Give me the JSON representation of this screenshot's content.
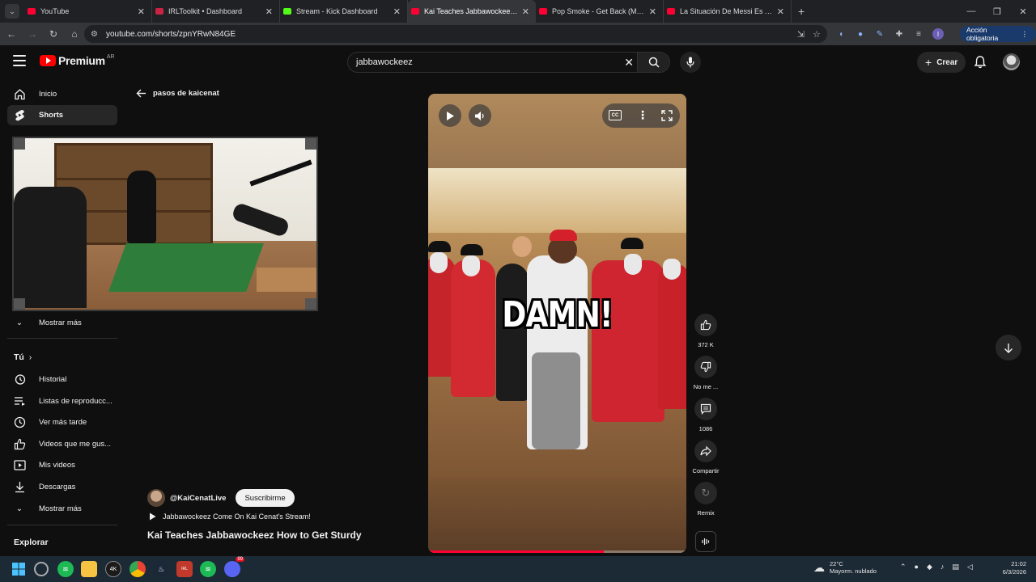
{
  "browser": {
    "tabs": [
      {
        "title": "YouTube",
        "color": "#ff0033",
        "active": false
      },
      {
        "title": "IRLToolkit • Dashboard",
        "color": "#cc2244",
        "active": false
      },
      {
        "title": "Stream - Kick Dashboard",
        "color": "#53fc18",
        "active": false
      },
      {
        "title": "Kai Teaches Jabbawockeez How",
        "color": "#ff0033",
        "active": true
      },
      {
        "title": "Pop Smoke - Get Back (Meet Th",
        "color": "#ff0033",
        "active": false
      },
      {
        "title": "La Situación De Messi Es Triste",
        "color": "#ff0033",
        "active": false
      }
    ],
    "url": "youtube.com/shorts/zpnYRwN84GE",
    "account_button": "Acción obligatoria",
    "profile_initial": "I"
  },
  "youtube": {
    "logo_text": "Premium",
    "country_code": "AR",
    "search_value": "jabbawockeez",
    "create_label": "Crear"
  },
  "sidebar": {
    "main": [
      {
        "label": "Inicio",
        "icon": "home-icon"
      },
      {
        "label": "Shorts",
        "icon": "shorts-icon"
      }
    ],
    "show_more_1": "Mostrar más",
    "you_heading": "Tú",
    "you_items": [
      {
        "label": "Historial",
        "icon": "history-icon"
      },
      {
        "label": "Listas de reproducc...",
        "icon": "playlist-icon"
      },
      {
        "label": "Ver más tarde",
        "icon": "clock-icon"
      },
      {
        "label": "Videos que me gus...",
        "icon": "like-icon"
      },
      {
        "label": "Mis videos",
        "icon": "my-videos-icon"
      },
      {
        "label": "Descargas",
        "icon": "download-icon"
      }
    ],
    "show_more_2": "Mostrar más",
    "explore_heading": "Explorar"
  },
  "short": {
    "back_label": "pasos de kaicenat",
    "caption_overlay": "DAMN!",
    "channel": "@KaiCenatLive",
    "subscribe_label": "Suscribirme",
    "playlist": "Jabbawockeez Come On Kai Cenat's Stream!",
    "title": "Kai Teaches Jabbawockeez How to Get Sturdy",
    "progress": 0.68,
    "actions": {
      "likes": "372 K",
      "dislike": "No me ...",
      "comments": "1086",
      "share": "Compartir",
      "remix": "Remix"
    }
  },
  "taskbar": {
    "temperature": "22°C",
    "weather": "Mayorm. nublado",
    "time": "21:02",
    "date": "6/3/2026",
    "discord_badge": "99"
  }
}
